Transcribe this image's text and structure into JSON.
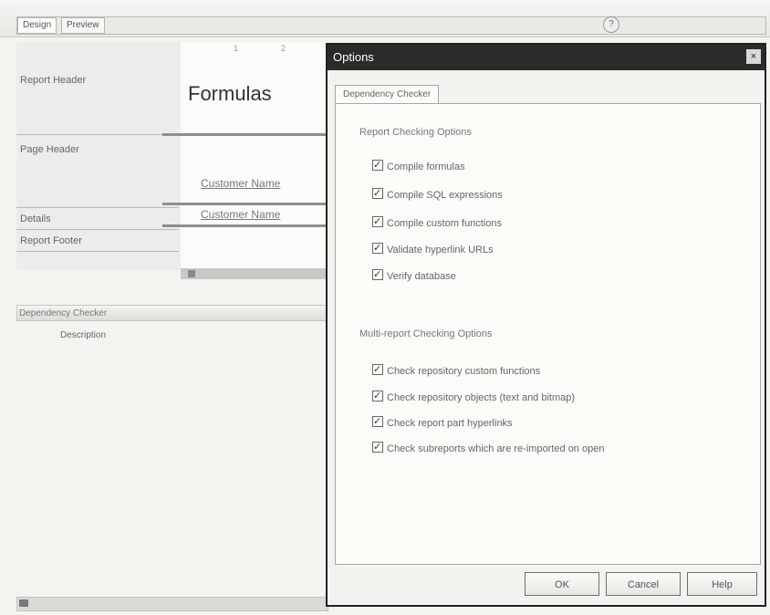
{
  "designer": {
    "tabs": [
      "Design",
      "Preview"
    ],
    "sections": [
      "Report Header",
      "Page Header",
      "Details",
      "Report Footer"
    ],
    "canvas_title": "Formulas",
    "fields": [
      "Customer Name",
      "Customer Name"
    ],
    "ruler_marks": [
      "1",
      "2"
    ],
    "help_glyph": "?"
  },
  "dependency": {
    "bar_label": "Dependency Checker",
    "row_label": "Description"
  },
  "dialog": {
    "title": "Options",
    "tab": "Dependency Checker",
    "report_group_label": "Report Checking Options",
    "report_options": [
      {
        "label": "Compile formulas",
        "checked": true
      },
      {
        "label": "Compile SQL expressions",
        "checked": true
      },
      {
        "label": "Compile custom functions",
        "checked": true
      },
      {
        "label": "Validate hyperlink URLs",
        "checked": true
      },
      {
        "label": "Verify database",
        "checked": true
      }
    ],
    "multi_group_label": "Multi-report Checking Options",
    "multi_options": [
      {
        "label": "Check repository custom functions",
        "checked": true
      },
      {
        "label": "Check repository objects (text and bitmap)",
        "checked": true
      },
      {
        "label": "Check report part hyperlinks",
        "checked": true
      },
      {
        "label": "Check subreports which are re-imported on open",
        "checked": true
      }
    ],
    "buttons": {
      "ok": "OK",
      "cancel": "Cancel",
      "help": "Help"
    },
    "close_glyph": "×"
  },
  "colors": {
    "dialog_title_bg": "#2b2b2b",
    "panel_bg": "#fbfbf8"
  }
}
